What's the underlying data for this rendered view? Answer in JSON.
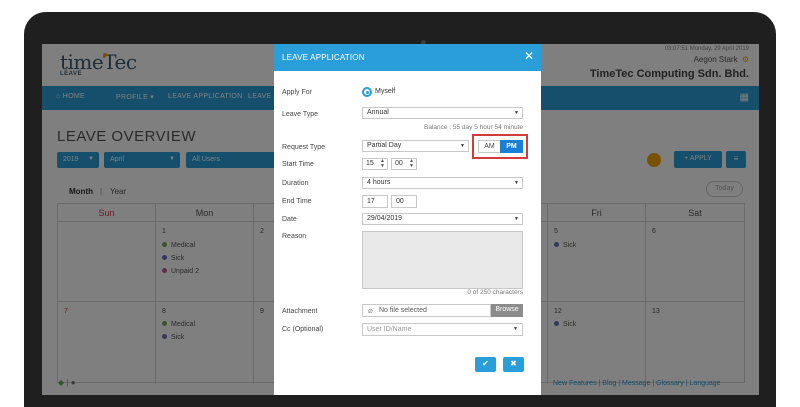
{
  "app": {
    "logo": "timeTec",
    "logo_sub": "LEAVE",
    "datetime": "03:07:51 Monday, 29 April 2019",
    "user": "Aegon Stark",
    "company": "TimeTec Computing Sdn. Bhd."
  },
  "nav": {
    "home": "HOME",
    "profile": "PROFILE",
    "leave_application": "LEAVE APPLICATION",
    "leave_a": "LEAVE A"
  },
  "page": {
    "title": "LEAVE OVERVIEW",
    "filter_year": "2019",
    "filter_month": "April",
    "filter_users": "All Users",
    "apply_label": "APPLY",
    "view_month": "Month",
    "view_year": "Year",
    "today_label": "Today"
  },
  "calendar": {
    "headers": [
      "Sun",
      "Mon",
      "Fri",
      "Sat"
    ],
    "sun_color": "#d43a3a",
    "row1": {
      "mon_day": "1",
      "mon_events": [
        "Medical",
        "Sick",
        "Unpaid 2"
      ],
      "tue_day": "2",
      "fri_day": "5",
      "fri_events": [
        "Sick"
      ],
      "sat_day": "6"
    },
    "row2": {
      "sun_day": "7",
      "mon_day": "8",
      "mon_events": [
        "Medical",
        "Sick"
      ],
      "tue_day": "9",
      "fri_day": "12",
      "fri_events": [
        "Sick"
      ],
      "sat_day": "13"
    },
    "event_colors": {
      "Medical": "#6ab04c",
      "Sick": "#6c6cc4",
      "Unpaid 2": "#c45a8c"
    }
  },
  "footer": {
    "links": "New Features  |  Blog  |  Message  |  Glossary  |  Language"
  },
  "modal": {
    "title": "LEAVE APPLICATION",
    "apply_for_label": "Apply For",
    "apply_for_value": "Myself",
    "leave_type_label": "Leave Type",
    "leave_type_value": "Annual",
    "balance": "Balance : 55 day 5 hour 54 minute",
    "request_type_label": "Request Type",
    "request_type_value": "Partial Day",
    "am_label": "AM",
    "pm_label": "PM",
    "start_time_label": "Start Time",
    "start_hour": "15",
    "start_minute": "00",
    "duration_label": "Duration",
    "duration_value": "4 hours",
    "end_time_label": "End Time",
    "end_hour": "17",
    "end_minute": "00",
    "date_label": "Date",
    "date_value": "29/04/2019",
    "reason_label": "Reason",
    "char_count": "0 of 250 characters",
    "attachment_label": "Attachment",
    "file_placeholder": "No file selected",
    "browse_label": "Browse",
    "cc_label": "Cc (Optional)",
    "cc_placeholder": "User ID/Name",
    "accent": "#2a9ed8",
    "highlight_color": "#d43a3a"
  }
}
